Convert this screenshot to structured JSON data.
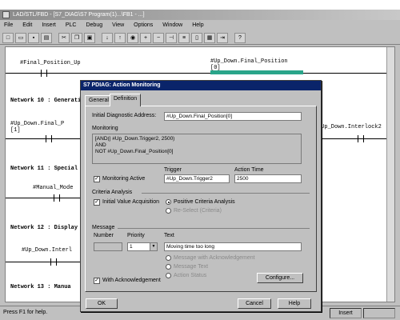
{
  "window": {
    "title": "LAD/STL/FBD - [S7_DIAG\\S7 Program(1)...\\FB1 - ...]"
  },
  "menu": [
    "File",
    "Edit",
    "Insert",
    "PLC",
    "Debug",
    "View",
    "Options",
    "Window",
    "Help"
  ],
  "editor": {
    "final_position_up": "#Final_Position_Up",
    "top_right_operand": "#Up_Down.Final_Position",
    "top_right_index": "[0]",
    "network10": "Network 10 : Generation",
    "n10_operand": "#Up_Down.Final_P",
    "n10_index": "[1]",
    "n10_right_operand": "#Up_Down.Interlock2",
    "network11": "Network 11 : Special",
    "n11_operand": "#Manual_Mode",
    "network12": "Network 12 : Display",
    "n12_operand": "#Up_Down.Interl",
    "network13": "Network 13 : Manua"
  },
  "status": {
    "help": "Press F1 for help.",
    "mode": "Insert"
  },
  "dialog": {
    "title": "S7 PDIAG: Action Monitoring",
    "tabs": [
      "General",
      "Definition"
    ],
    "initial_address_label": "Initial Diagnostic Address:",
    "initial_address_value": "#Up_Down.Final_Position[0]",
    "monitoring_label": "Monitoring",
    "monitoring_lines": [
      "[AND(| #Up_Down.Trigger2, 2500)",
      "AND",
      "NOT #Up_Down.Final_Position[0]"
    ],
    "trigger_label": "Trigger",
    "action_time_label": "Action Time",
    "monitoring_active_label": "Monitoring Active",
    "trigger_value": "#Up_Down.Trigger2",
    "action_time_value": "2500",
    "criteria_label": "Criteria Analysis",
    "initial_value_label": "Initial Value Acquisition",
    "positive_label": "Positive Criteria Analysis",
    "negative_label": "Re-Select (Criteria)",
    "message_label": "Message",
    "number_label": "Number",
    "priority_label": "Priority",
    "text_label": "Text",
    "priority_value": "1",
    "text_value": "Moving time too long",
    "opt1": "Message with Acknowledgement",
    "opt2": "Message Text",
    "opt3": "Action Status",
    "with_ack_label": "With Acknowledgement",
    "configure_label": "Configure...",
    "ok_label": "OK",
    "cancel_label": "Cancel",
    "help_label": "Help"
  }
}
